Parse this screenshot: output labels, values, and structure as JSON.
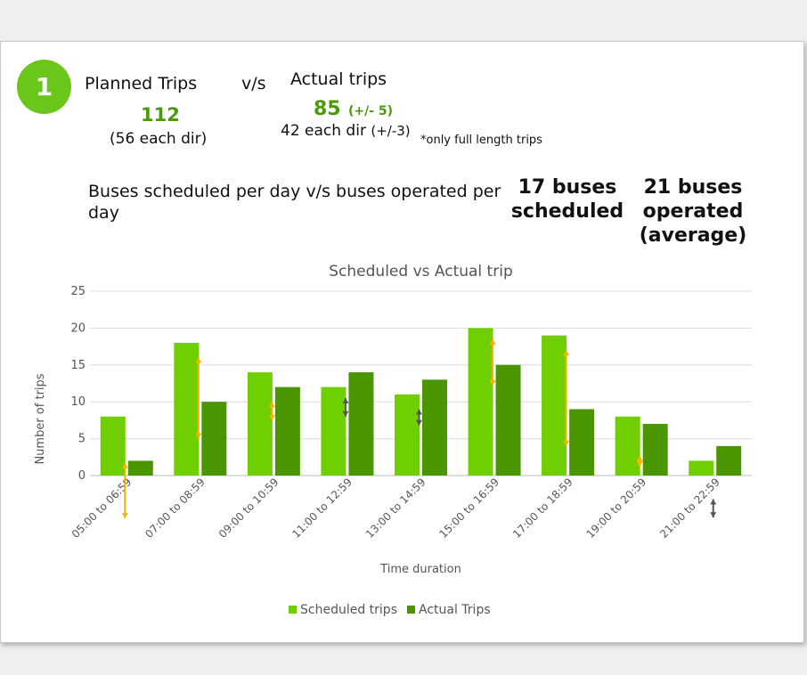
{
  "header": {
    "step_number": "1",
    "planned_label": "Planned Trips",
    "vs_label": "v/s",
    "actual_label": "Actual trips",
    "planned_value": "112",
    "planned_sub": "(56 each dir)",
    "actual_value": "85",
    "actual_range": "(+/- 5)",
    "actual_sub_main": "42 each dir",
    "actual_sub_range": "(+/-3)",
    "footnote": "*only full length trips"
  },
  "buses": {
    "question": "Buses scheduled per day v/s buses operated per day",
    "scheduled_line1": "17 buses",
    "scheduled_line2": "scheduled",
    "operated_line1": "21 buses",
    "operated_line2": "operated",
    "operated_line3": "(average)"
  },
  "colors": {
    "scheduled": "#6fcf00",
    "actual": "#4a9600",
    "error_orange": "#f5b400",
    "error_dark": "#555555",
    "badge": "#6bc61a",
    "headline_green": "#4c9a0a"
  },
  "chart_data": {
    "type": "bar",
    "title": "Scheduled vs Actual trip",
    "xlabel": "Time duration",
    "ylabel": "Number of trips",
    "ylim": [
      0,
      25
    ],
    "yticks": [
      0,
      5,
      10,
      15,
      20,
      25
    ],
    "grid": true,
    "legend_position": "bottom",
    "categories": [
      "05:00 to 06:59",
      "07:00 to 08:59",
      "09:00 to 10:59",
      "11:00 to 12:59",
      "13:00 to 14:59",
      "15:00 to 16:59",
      "17:00 to 18:59",
      "19:00 to 20:59",
      "21:00 to 22:59"
    ],
    "series": [
      {
        "name": "Scheduled trips",
        "values": [
          8,
          18,
          14,
          12,
          11,
          20,
          19,
          8,
          2
        ]
      },
      {
        "name": "Actual Trips",
        "values": [
          2,
          10,
          12,
          14,
          13,
          15,
          9,
          7,
          4
        ]
      }
    ],
    "difference_arrows": [
      {
        "from": 1.7,
        "to": -5.8,
        "color": "orange"
      },
      {
        "from": 16.0,
        "to": 5.0,
        "color": "orange"
      },
      {
        "from": 10.0,
        "to": 7.5,
        "color": "orange"
      },
      {
        "from": 10.5,
        "to": 8.0,
        "color": "dark"
      },
      {
        "from": 9.0,
        "to": 6.8,
        "color": "dark"
      },
      {
        "from": 18.5,
        "to": 12.2,
        "color": "orange"
      },
      {
        "from": 17.0,
        "to": 4.0,
        "color": "orange"
      },
      {
        "from": 2.7,
        "to": 1.2,
        "color": "orange"
      },
      {
        "from": -3.2,
        "to": -5.7,
        "color": "dark"
      }
    ]
  }
}
